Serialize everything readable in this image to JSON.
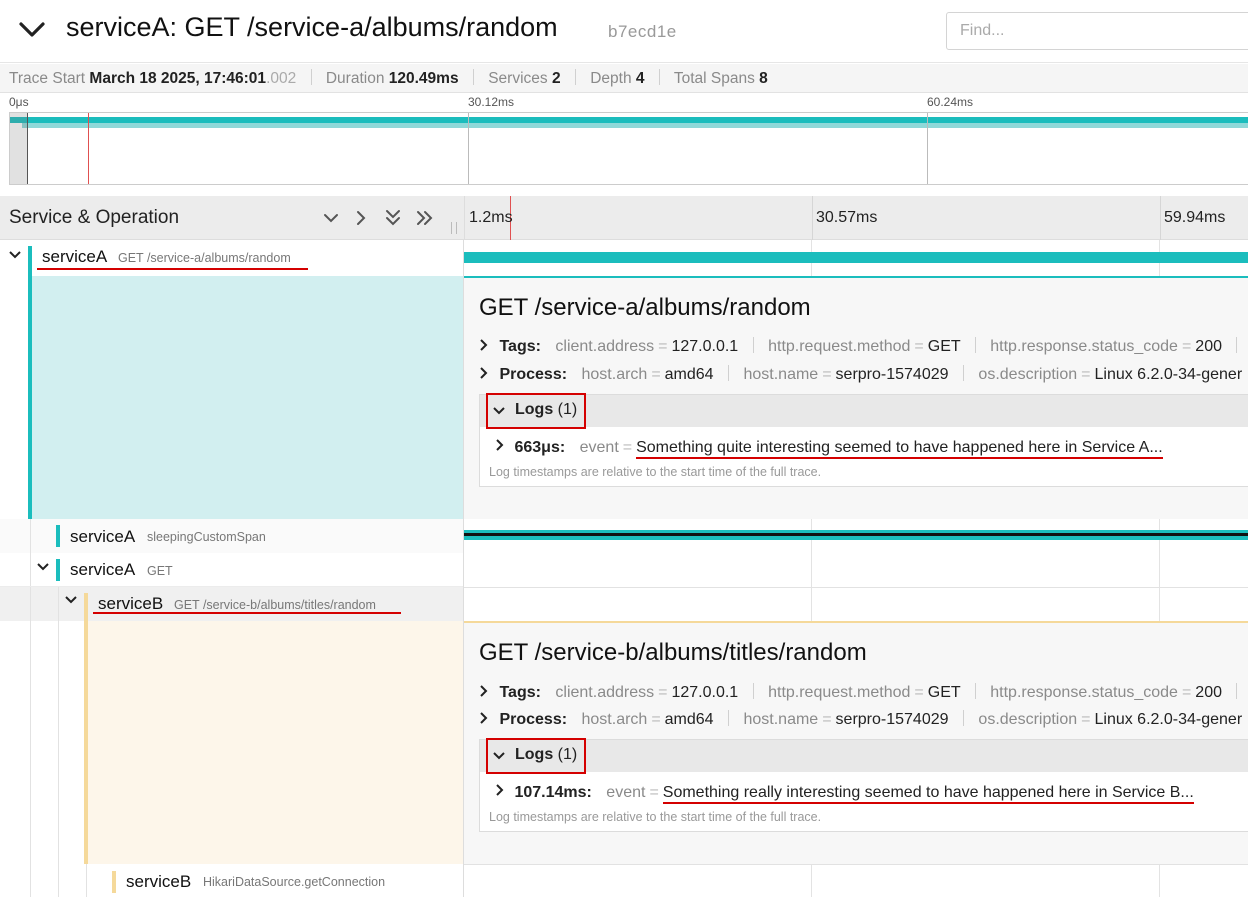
{
  "header": {
    "title": "serviceA: GET /service-a/albums/random",
    "trace_id": "b7ecd1e",
    "find_placeholder": "Find..."
  },
  "summary": {
    "trace_start_label": "Trace Start",
    "trace_start_value": "March 18 2025, 17:46:01",
    "trace_start_ms": ".002",
    "duration_label": "Duration",
    "duration_value": "120.49ms",
    "services_label": "Services",
    "services_value": "2",
    "depth_label": "Depth",
    "depth_value": "4",
    "total_spans_label": "Total Spans",
    "total_spans_value": "8"
  },
  "minimap": {
    "ticks": [
      "0μs",
      "30.12ms",
      "60.24ms"
    ]
  },
  "columns": {
    "service_operation": "Service & Operation",
    "timeline_ticks": [
      "1.2ms",
      "30.57ms",
      "59.94ms"
    ]
  },
  "spans": [
    {
      "service": "serviceA",
      "operation": "GET /service-a/albums/random",
      "color": "#1bbdbd"
    },
    {
      "service": "serviceA",
      "operation": "sleepingCustomSpan",
      "color": "#1bbdbd"
    },
    {
      "service": "serviceA",
      "operation": "GET",
      "color": "#1bbdbd"
    },
    {
      "service": "serviceB",
      "operation": "GET /service-b/albums/titles/random",
      "color": "#f5d99a"
    },
    {
      "service": "serviceB",
      "operation": "HikariDataSource.getConnection",
      "color": "#f5d99a"
    }
  ],
  "details": [
    {
      "title": "GET /service-a/albums/random",
      "tags_label": "Tags:",
      "tags": [
        {
          "k": "client.address",
          "v": "127.0.0.1"
        },
        {
          "k": "http.request.method",
          "v": "GET"
        },
        {
          "k": "http.response.status_code",
          "v": "200"
        }
      ],
      "process_label": "Process:",
      "process": [
        {
          "k": "host.arch",
          "v": "amd64"
        },
        {
          "k": "host.name",
          "v": "serpro-1574029"
        },
        {
          "k": "os.description",
          "v": "Linux 6.2.0-34-gener"
        }
      ],
      "logs_label": "Logs",
      "logs_count": "(1)",
      "log": {
        "time": "663μs:",
        "key": "event",
        "message": "Something quite interesting seemed to have happened here in Service A..."
      },
      "log_note": "Log timestamps are relative to the start time of the full trace."
    },
    {
      "title": "GET /service-b/albums/titles/random",
      "tags_label": "Tags:",
      "tags": [
        {
          "k": "client.address",
          "v": "127.0.0.1"
        },
        {
          "k": "http.request.method",
          "v": "GET"
        },
        {
          "k": "http.response.status_code",
          "v": "200"
        }
      ],
      "process_label": "Process:",
      "process": [
        {
          "k": "host.arch",
          "v": "amd64"
        },
        {
          "k": "host.name",
          "v": "serpro-1574029"
        },
        {
          "k": "os.description",
          "v": "Linux 6.2.0-34-gener"
        }
      ],
      "logs_label": "Logs",
      "logs_count": "(1)",
      "log": {
        "time": "107.14ms:",
        "key": "event",
        "message": "Something really interesting seemed to have happened here in Service B..."
      },
      "log_note": "Log timestamps are relative to the start time of the full trace."
    }
  ],
  "colors": {
    "service_a": "#1bbdbd",
    "service_b": "#f5d99a",
    "highlight": "#d40000"
  }
}
